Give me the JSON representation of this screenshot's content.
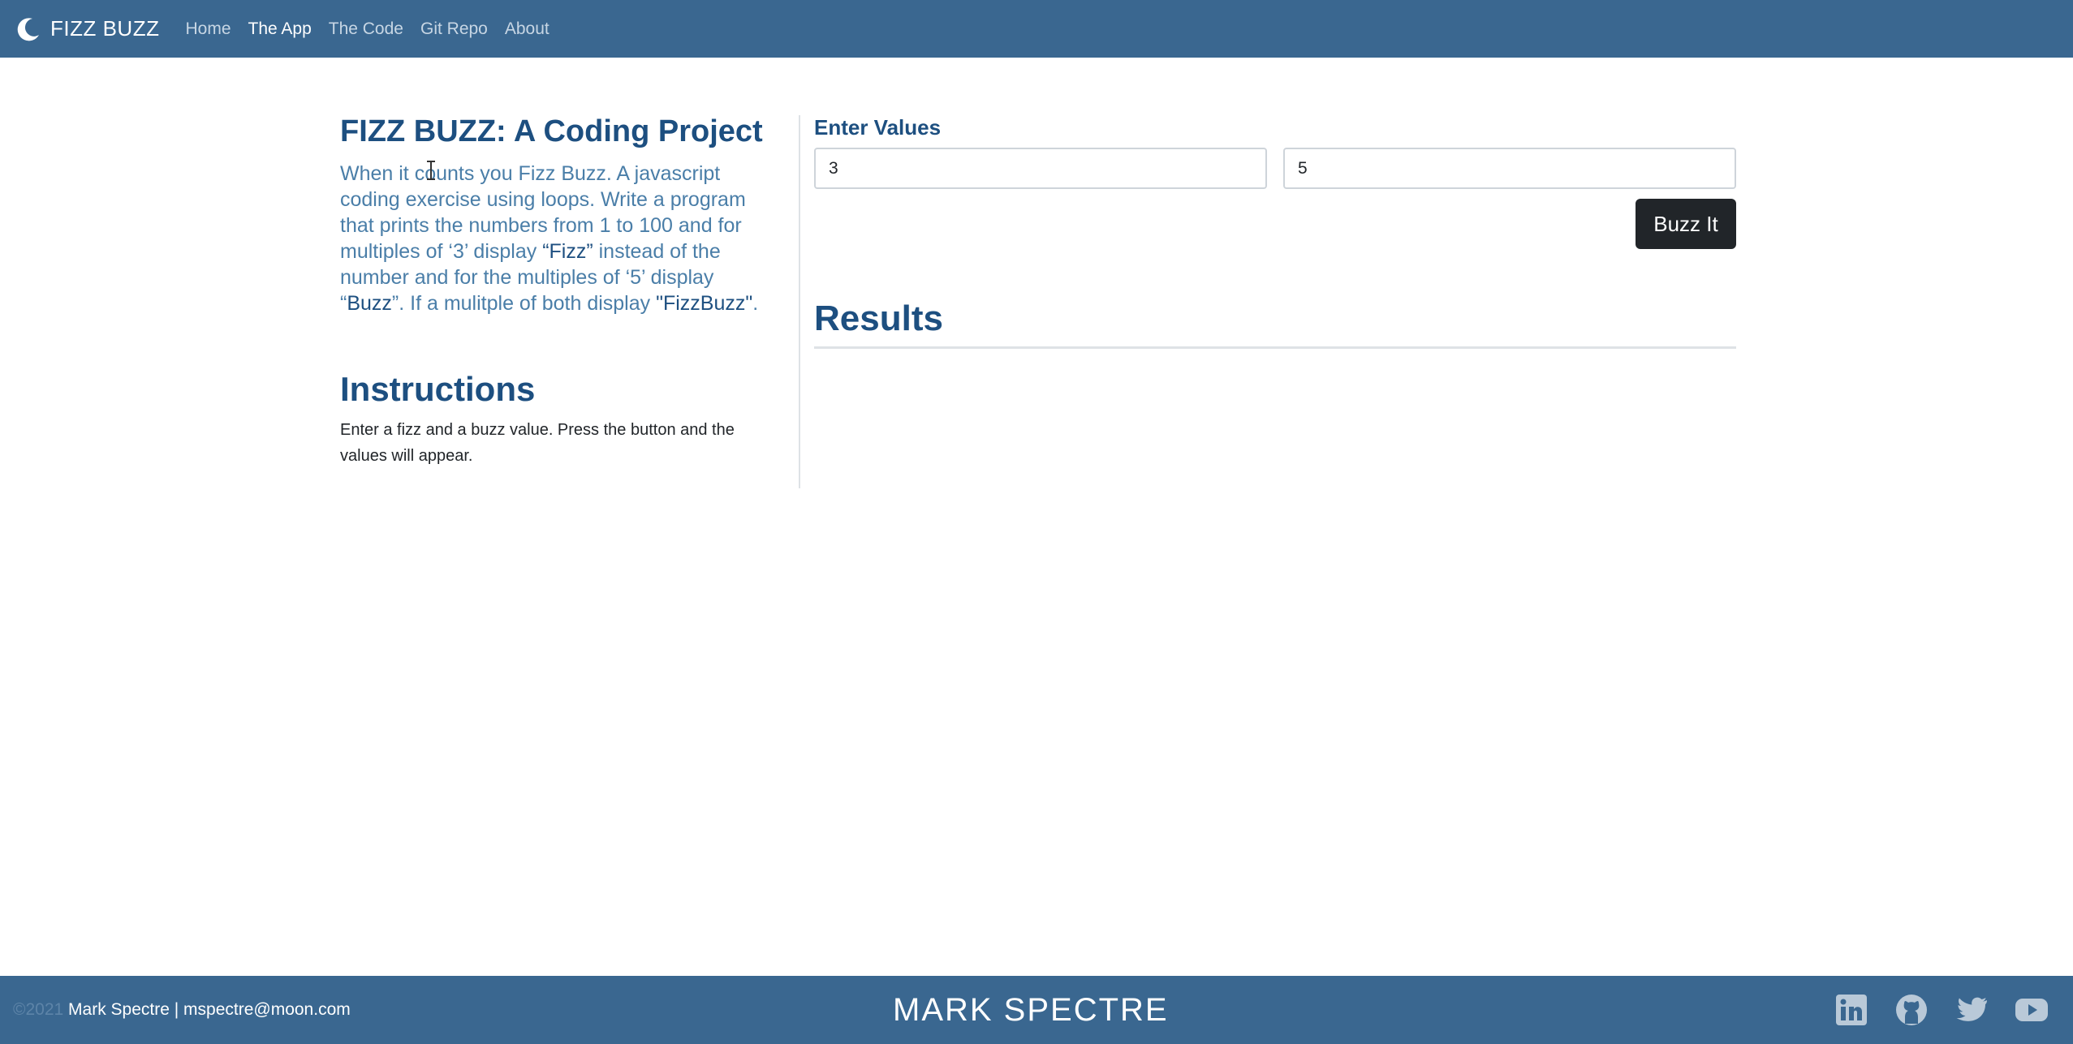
{
  "nav": {
    "brand": "FIZZ BUZZ",
    "links": [
      {
        "label": "Home",
        "active": false
      },
      {
        "label": "The App",
        "active": true
      },
      {
        "label": "The Code",
        "active": false
      },
      {
        "label": "Git Repo",
        "active": false
      },
      {
        "label": "About",
        "active": false
      }
    ]
  },
  "left": {
    "title": "FIZZ BUZZ: A Coding Project",
    "intro_before_fizz": "When it counts you Fizz Buzz. A javascript coding exercise using loops. Write a program that prints the numbers from 1 to 100 and for multiples of ‘3’ display ",
    "fizz": "“Fizz”",
    "intro_mid": " instead of the number and for the multiples of ‘5’ display “",
    "buzz": "Buzz",
    "intro_after_buzz": "”. If a mulitple of both display ",
    "fizzbuzz": "\"FizzBuzz\"",
    "intro_end": ".",
    "instructions_title": "Instructions",
    "instructions_text": "Enter a fizz and a buzz value. Press the button and the values will appear."
  },
  "right": {
    "enter_label": "Enter Values",
    "fizz_value": "3",
    "buzz_value": "5",
    "button_label": "Buzz It",
    "results_title": "Results"
  },
  "footer": {
    "copyright": "©2021",
    "author": " Mark Spectre | mspectre@moon.com",
    "logo": "MARK SPECTRE",
    "social_icons": [
      "linkedin-icon",
      "github-icon",
      "twitter-icon",
      "youtube-icon"
    ]
  },
  "colors": {
    "navbar": "#3a6790",
    "heading": "#1d4f80",
    "intro_text": "#4a7ea8",
    "button": "#212529"
  }
}
